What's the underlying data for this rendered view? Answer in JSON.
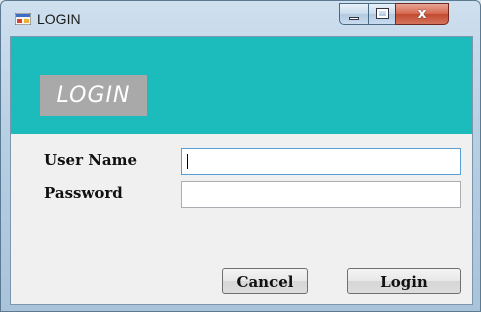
{
  "window": {
    "title": "LOGIN",
    "icon": "winforms-app-icon",
    "controls": {
      "minimize": "minimize-icon",
      "maximize": "maximize-icon",
      "close": "close-icon",
      "close_glyph": "x"
    }
  },
  "header": {
    "label": "LOGIN",
    "background_color": "#1cbcbc",
    "label_background_color": "#a9a9a9"
  },
  "form": {
    "username": {
      "label": "User Name",
      "value": "",
      "placeholder": ""
    },
    "password": {
      "label": "Password",
      "value": "",
      "placeholder": ""
    }
  },
  "buttons": {
    "cancel": "Cancel",
    "login": "Login"
  }
}
